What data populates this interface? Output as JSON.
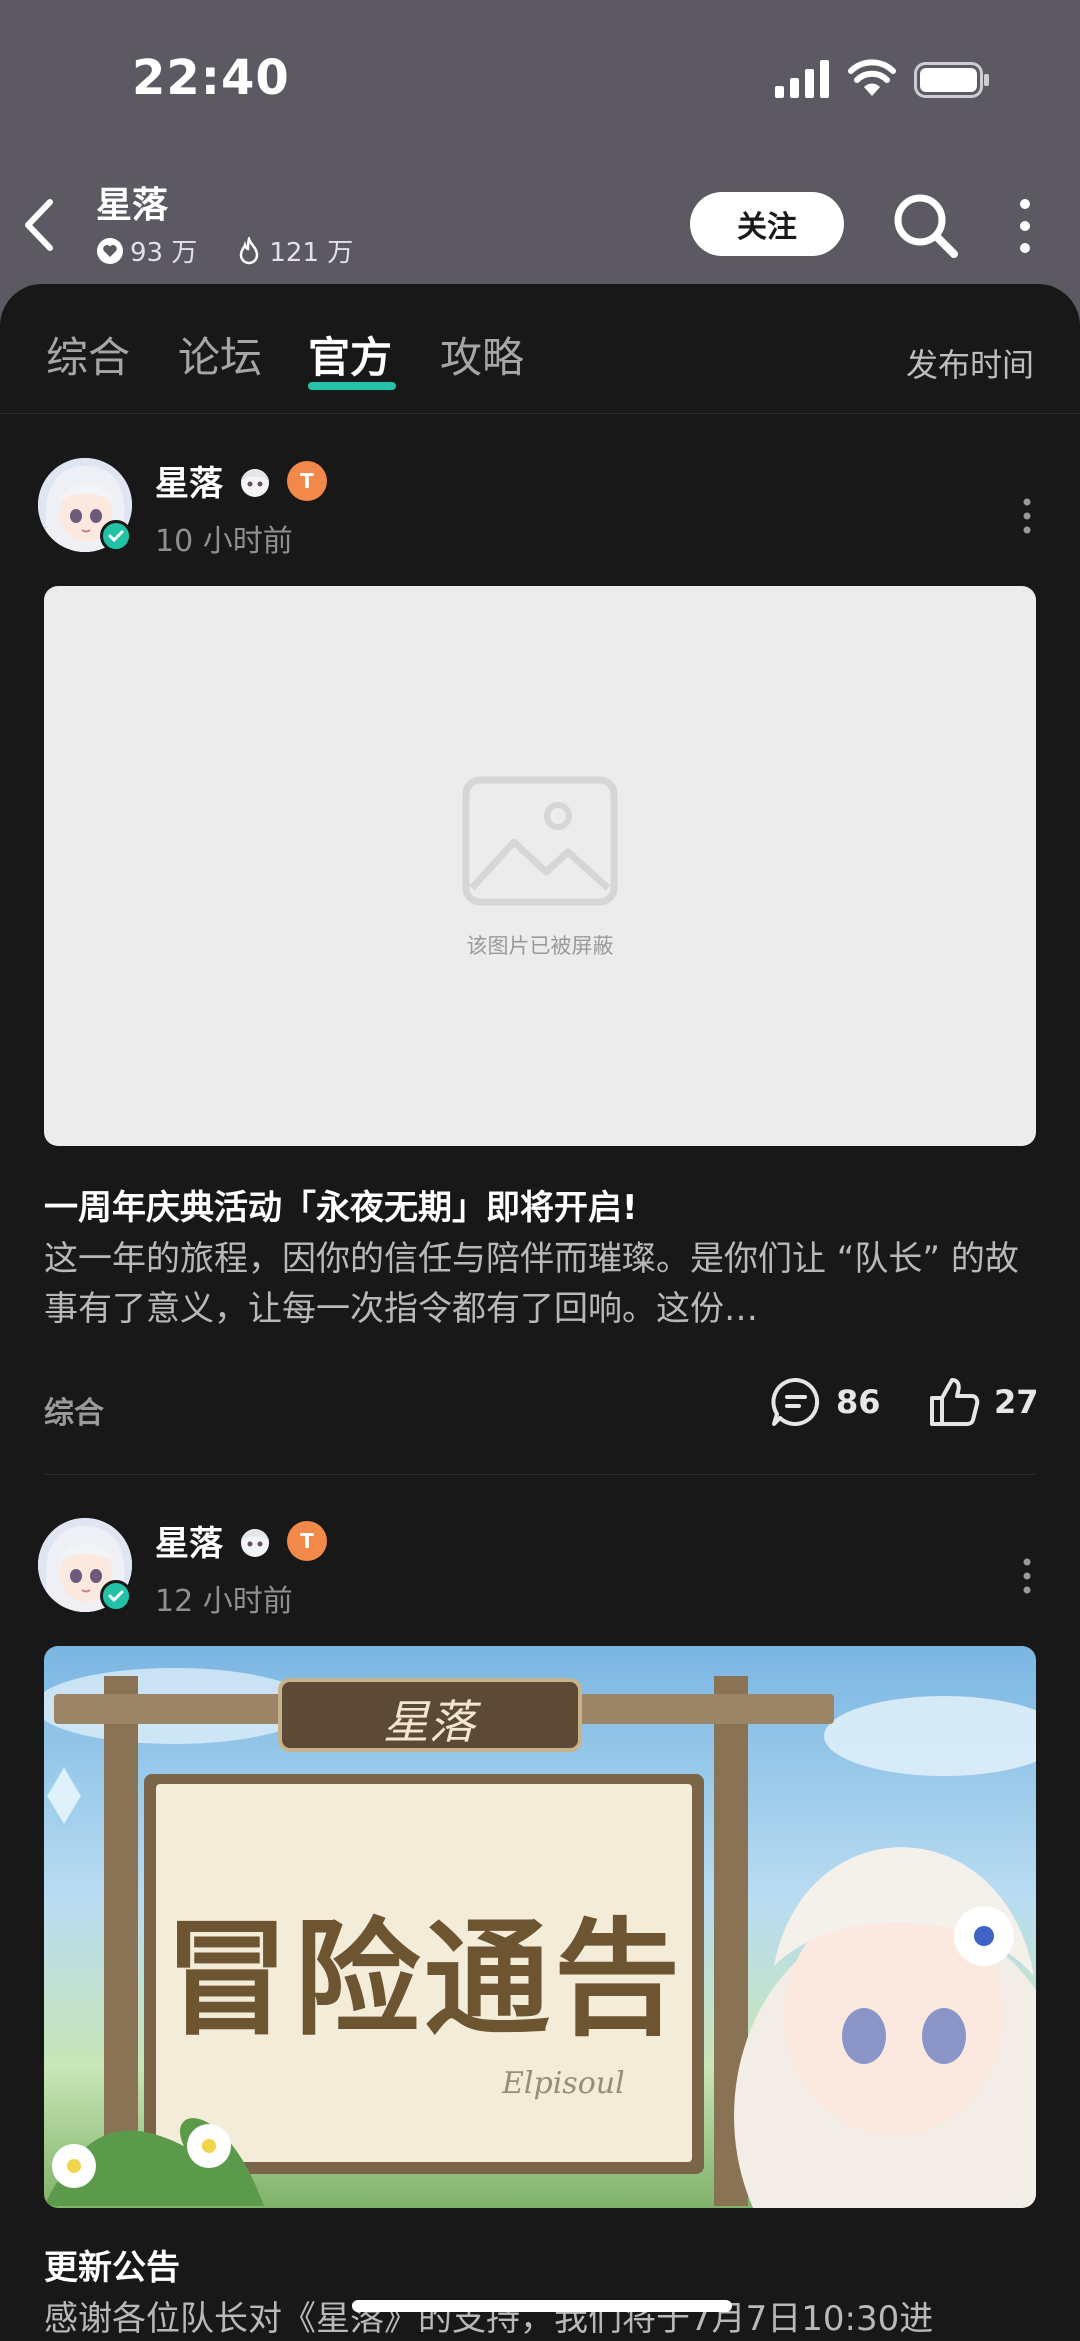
{
  "status_bar": {
    "time": "22:40"
  },
  "header": {
    "title": "星落",
    "followers": "93 万",
    "heat": "121 万",
    "follow_label": "关注"
  },
  "tabs": {
    "items": [
      "综合",
      "论坛",
      "官方",
      "攻略"
    ],
    "active": "官方",
    "sort_label": "发布时间"
  },
  "posts": [
    {
      "author": "星落",
      "time": "10 小时前",
      "image_blocked_text": "该图片已被屏蔽",
      "title": "一周年庆典活动「永夜无期」即将开启!",
      "body": "这一年的旅程，因你的信任与陪伴而璀璨。是你们让 “队长” 的故事有了意义，让每一次指令都有了回响。这份…",
      "category": "综合",
      "comments": "86",
      "likes": "27"
    },
    {
      "author": "星落",
      "time": "12 小时前",
      "banner_text": "冒险通告",
      "banner_logo": "星落",
      "banner_sign": "Elpisoul",
      "title": "更新公告",
      "body": "感谢各位队长对《星落》的支持，我们将于7月7日10:30进"
    }
  ],
  "colors": {
    "accent": "#25c4a9",
    "sheet_bg": "#181818",
    "header_bg": "#5c5962",
    "badge": "#f2884a"
  }
}
